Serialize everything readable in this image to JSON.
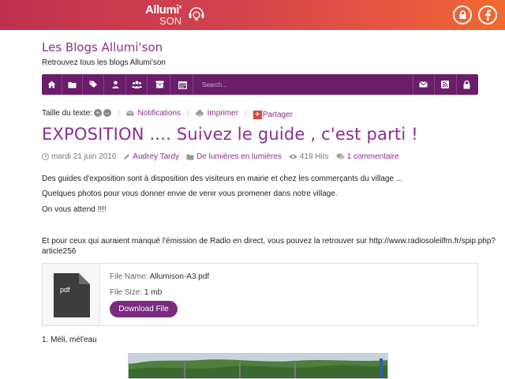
{
  "brand": {
    "logo_line1": "Allumi'",
    "logo_line2": "SON"
  },
  "top_icons": [
    "lock-icon",
    "facebook-icon"
  ],
  "site": {
    "title": "Les Blogs Allumi'son",
    "subtitle": "Retrouvez tous les blogs Allumi'son"
  },
  "navbar": {
    "left_icons": [
      "home-icon",
      "folder-icon",
      "tags-icon",
      "user-icon",
      "users-icon",
      "archive-icon",
      "calendar-icon"
    ],
    "search_placeholder": "Search...",
    "right_icons": [
      "envelope-icon",
      "rss-icon",
      "lock-icon"
    ]
  },
  "tools": {
    "text_size_label": "Taille du texte:",
    "increase": "+",
    "decrease": "–",
    "notifications": "Notifications",
    "print": "Imprimer",
    "share": "Partager"
  },
  "article": {
    "title": "EXPOSITION .... Suivez le guide , c'est parti !",
    "meta": {
      "date": "mardi 21 juin 2016",
      "author": "Audrey Tardy",
      "category": "De lumières en lumières",
      "hits": "419 Hits",
      "comments": "1 commentaire"
    },
    "paragraphs": [
      "Des guides d'exposition sont à disposition des visiteurs en mairie et chez les commerçants du village ...",
      "Quelques photos pour vous donner envie de venir vous promener dans notre village.",
      "On vous attend !!!!"
    ],
    "radio_text_line1": "Et pour ceux qui auraient manqué l'émission de Radio en direct, vous pouvez la retrouver sur   http://www.radiosoleilfm.fr/spip.php?",
    "radio_text_line2": "article256",
    "list_item": "1. Méli, mél'eau"
  },
  "attachment": {
    "file_type": "pdf",
    "file_name_label": "File Name:",
    "file_name": "Allumison-A3.pdf",
    "file_size_label": "File Size:",
    "file_size": "1 mb",
    "download_label": "Download File"
  },
  "colors": {
    "accent": "#8d2e8c",
    "navbar": "#6a1e6a",
    "header_gradient_start": "#c0314f",
    "header_gradient_end": "#f06a30",
    "button": "#7b2a80"
  }
}
